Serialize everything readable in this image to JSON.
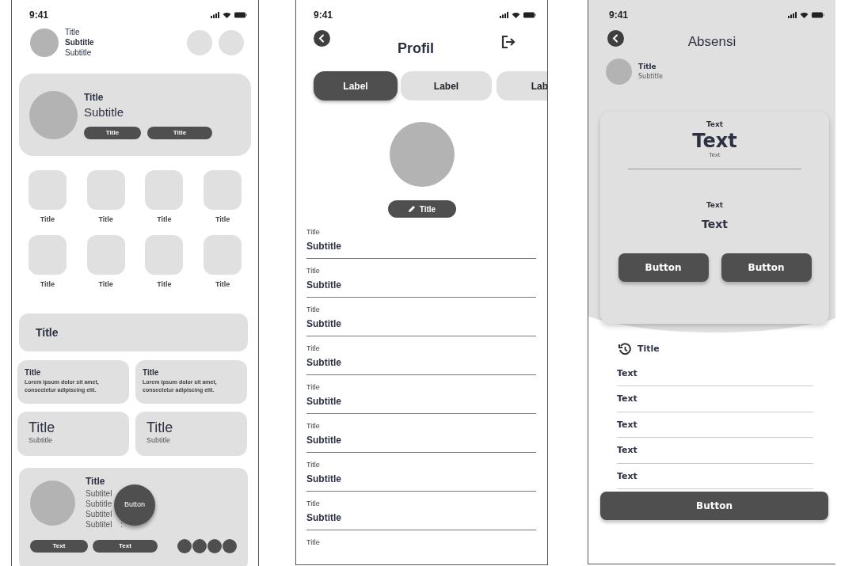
{
  "home": {
    "time": "9:41",
    "header": {
      "title": "Title",
      "subtitle": "Subtitle",
      "caption": "Subtitle"
    },
    "hero": {
      "title": "Title",
      "subtitle": "Subtitle",
      "buttons": [
        "Title",
        "Title"
      ]
    },
    "shortcuts": [
      "Title",
      "Title",
      "Title",
      "Title",
      "Title",
      "Title",
      "Title",
      "Title"
    ],
    "banner": {
      "title": "Title"
    },
    "info_cards": [
      {
        "title": "Title",
        "body": "Lorem ipsum dolor sit amet, consectetur adipiscing elit."
      },
      {
        "title": "Title",
        "body": "Lorem ipsum dolor sit amet, consectetur adipiscing elit."
      }
    ],
    "stat_cards": [
      {
        "title": "Title",
        "subtitle": "Subtitle"
      },
      {
        "title": "Title",
        "subtitle": "Subtitle"
      }
    ],
    "detail_card": {
      "title": "Title",
      "lines": [
        "Subtitel",
        "Subtitle",
        "Subtitel",
        "Subtitel"
      ],
      "trailing": ":",
      "fab": "Button",
      "chips": [
        "Text",
        "Text"
      ]
    }
  },
  "profile": {
    "time": "9:41",
    "title": "Profil",
    "tabs": [
      {
        "label": "Label",
        "selected": true
      },
      {
        "label": "Label",
        "selected": false
      },
      {
        "label": "Lab",
        "selected": false
      }
    ],
    "edit_button": "Title",
    "fields": [
      {
        "label": "Title",
        "value": "Subtitle"
      },
      {
        "label": "Title",
        "value": "Subtitle"
      },
      {
        "label": "Title",
        "value": "Subtitle"
      },
      {
        "label": "Title",
        "value": "Subtitle"
      },
      {
        "label": "Title",
        "value": "Subtitle"
      },
      {
        "label": "Title",
        "value": "Subtitle"
      },
      {
        "label": "Title",
        "value": "Subtitle"
      },
      {
        "label": "Title",
        "value": "Subtitle"
      },
      {
        "label": "Title"
      }
    ]
  },
  "attendance": {
    "time": "9:41",
    "title": "Absensi",
    "user": {
      "name": "Title",
      "subtitle": "Subtitle"
    },
    "summary": {
      "caption": "Text",
      "value": "Text",
      "note": "Text",
      "secondary_caption": "Text",
      "secondary_value": "Text",
      "buttons": [
        "Button",
        "Button"
      ]
    },
    "history": {
      "title": "Title",
      "items": [
        "Text",
        "Text",
        "Text",
        "Text",
        "Text"
      ]
    },
    "button": "Button"
  }
}
